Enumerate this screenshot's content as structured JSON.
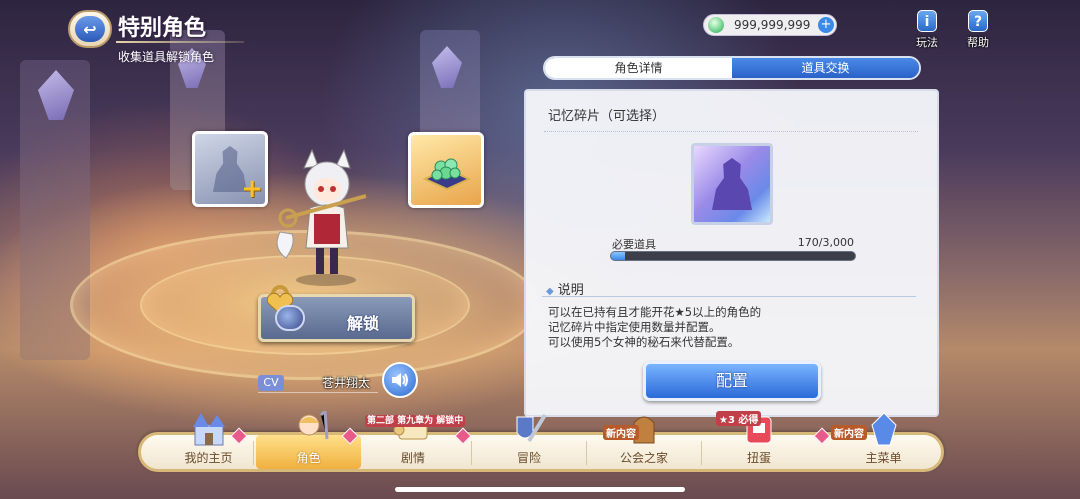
{
  "header": {
    "title": "特别角色",
    "subtitle": "收集道具解锁角色",
    "currency_value": "999,999,999",
    "howto_label": "玩法",
    "help_label": "帮助"
  },
  "tabs": [
    {
      "label": "角色详情",
      "active": false
    },
    {
      "label": "道具交换",
      "active": true
    }
  ],
  "panel": {
    "title": "记忆碎片（可选择）",
    "required_label": "必要道具",
    "required_count": "170/3,000",
    "progress_fraction": 0.057,
    "description_heading": "说明",
    "description_lines": [
      "可以在已持有且才能开花★5以上的角色的",
      "记忆碎片中指定使用数量并配置。",
      "可以使用5个女神的秘石来代替配置。"
    ],
    "config_button": "配置"
  },
  "left": {
    "unlock_label": "解锁",
    "cv_label": "CV",
    "cv_name": "苍井翔太"
  },
  "nav": {
    "items": [
      "我的主页",
      "角色",
      "剧情",
      "冒险",
      "公会之家",
      "扭蛋",
      "主菜单"
    ],
    "active_index": 1,
    "story_badge": "第二部 第九章为 解锁中",
    "guild_badge": "新内容",
    "gacha_badge": "★3 必得",
    "menu_badge": "新内容"
  },
  "colors": {
    "accent_blue": "#2a6ad8",
    "nav_active": "#f0b040"
  }
}
